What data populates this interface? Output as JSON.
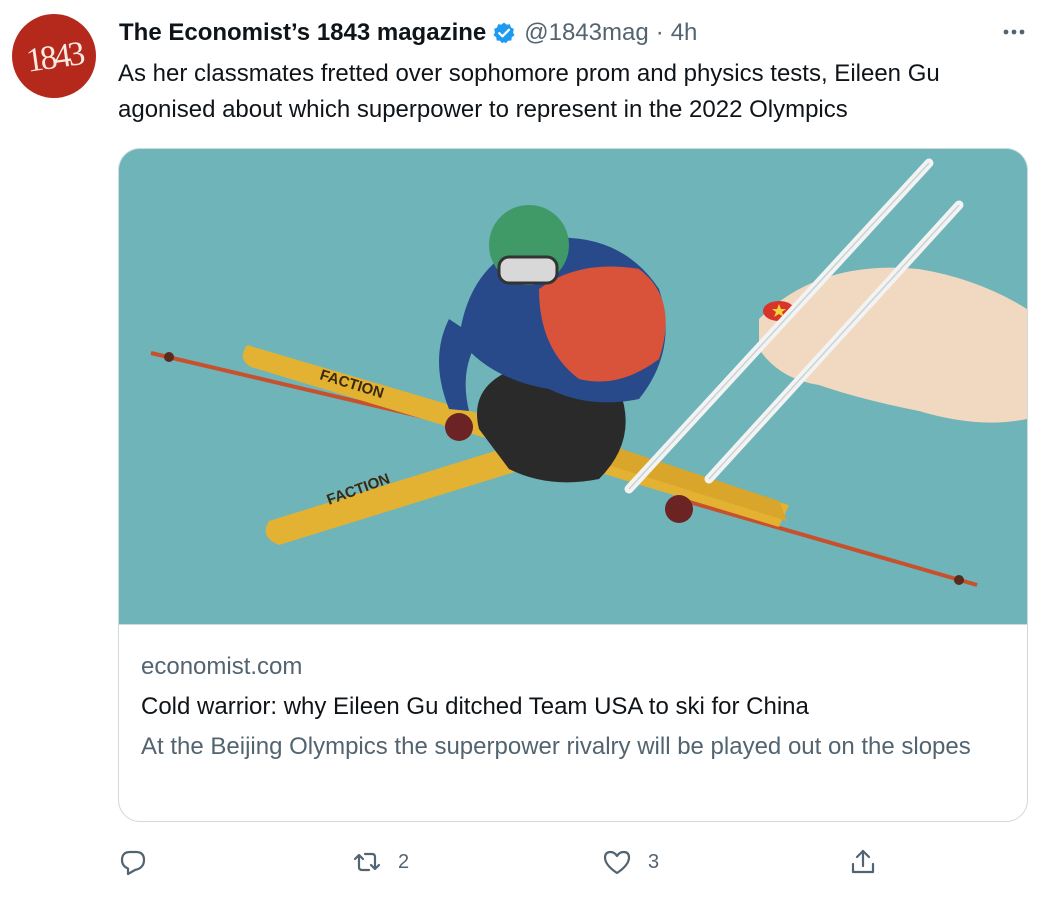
{
  "author": {
    "avatar_text": "1843",
    "display_name": "The Economist’s 1843 magazine",
    "handle": "@1843mag",
    "separator": "·",
    "time": "4h"
  },
  "tweet": {
    "text": "As her classmates fretted over sophomore prom and physics tests, Eileen Gu agonised about which superpower to represent in the 2022 Olympics"
  },
  "card": {
    "image_labels": [
      "FACTION",
      "FACTION"
    ],
    "domain": "economist.com",
    "title": "Cold warrior: why Eileen Gu ditched Team USA to ski for China",
    "description": "At the Beijing Olympics the superpower rivalry will be played out on the slopes"
  },
  "actions": {
    "reply": {
      "icon": "reply-icon",
      "count": ""
    },
    "retweet": {
      "icon": "retweet-icon",
      "count": "2"
    },
    "like": {
      "icon": "heart-icon",
      "count": "3"
    },
    "share": {
      "icon": "share-icon",
      "count": ""
    }
  },
  "colors": {
    "verified": "#1d9bf0",
    "avatar_bg": "#b5281c",
    "image_bg": "#6eb4b9",
    "secondary_text": "#536471"
  }
}
